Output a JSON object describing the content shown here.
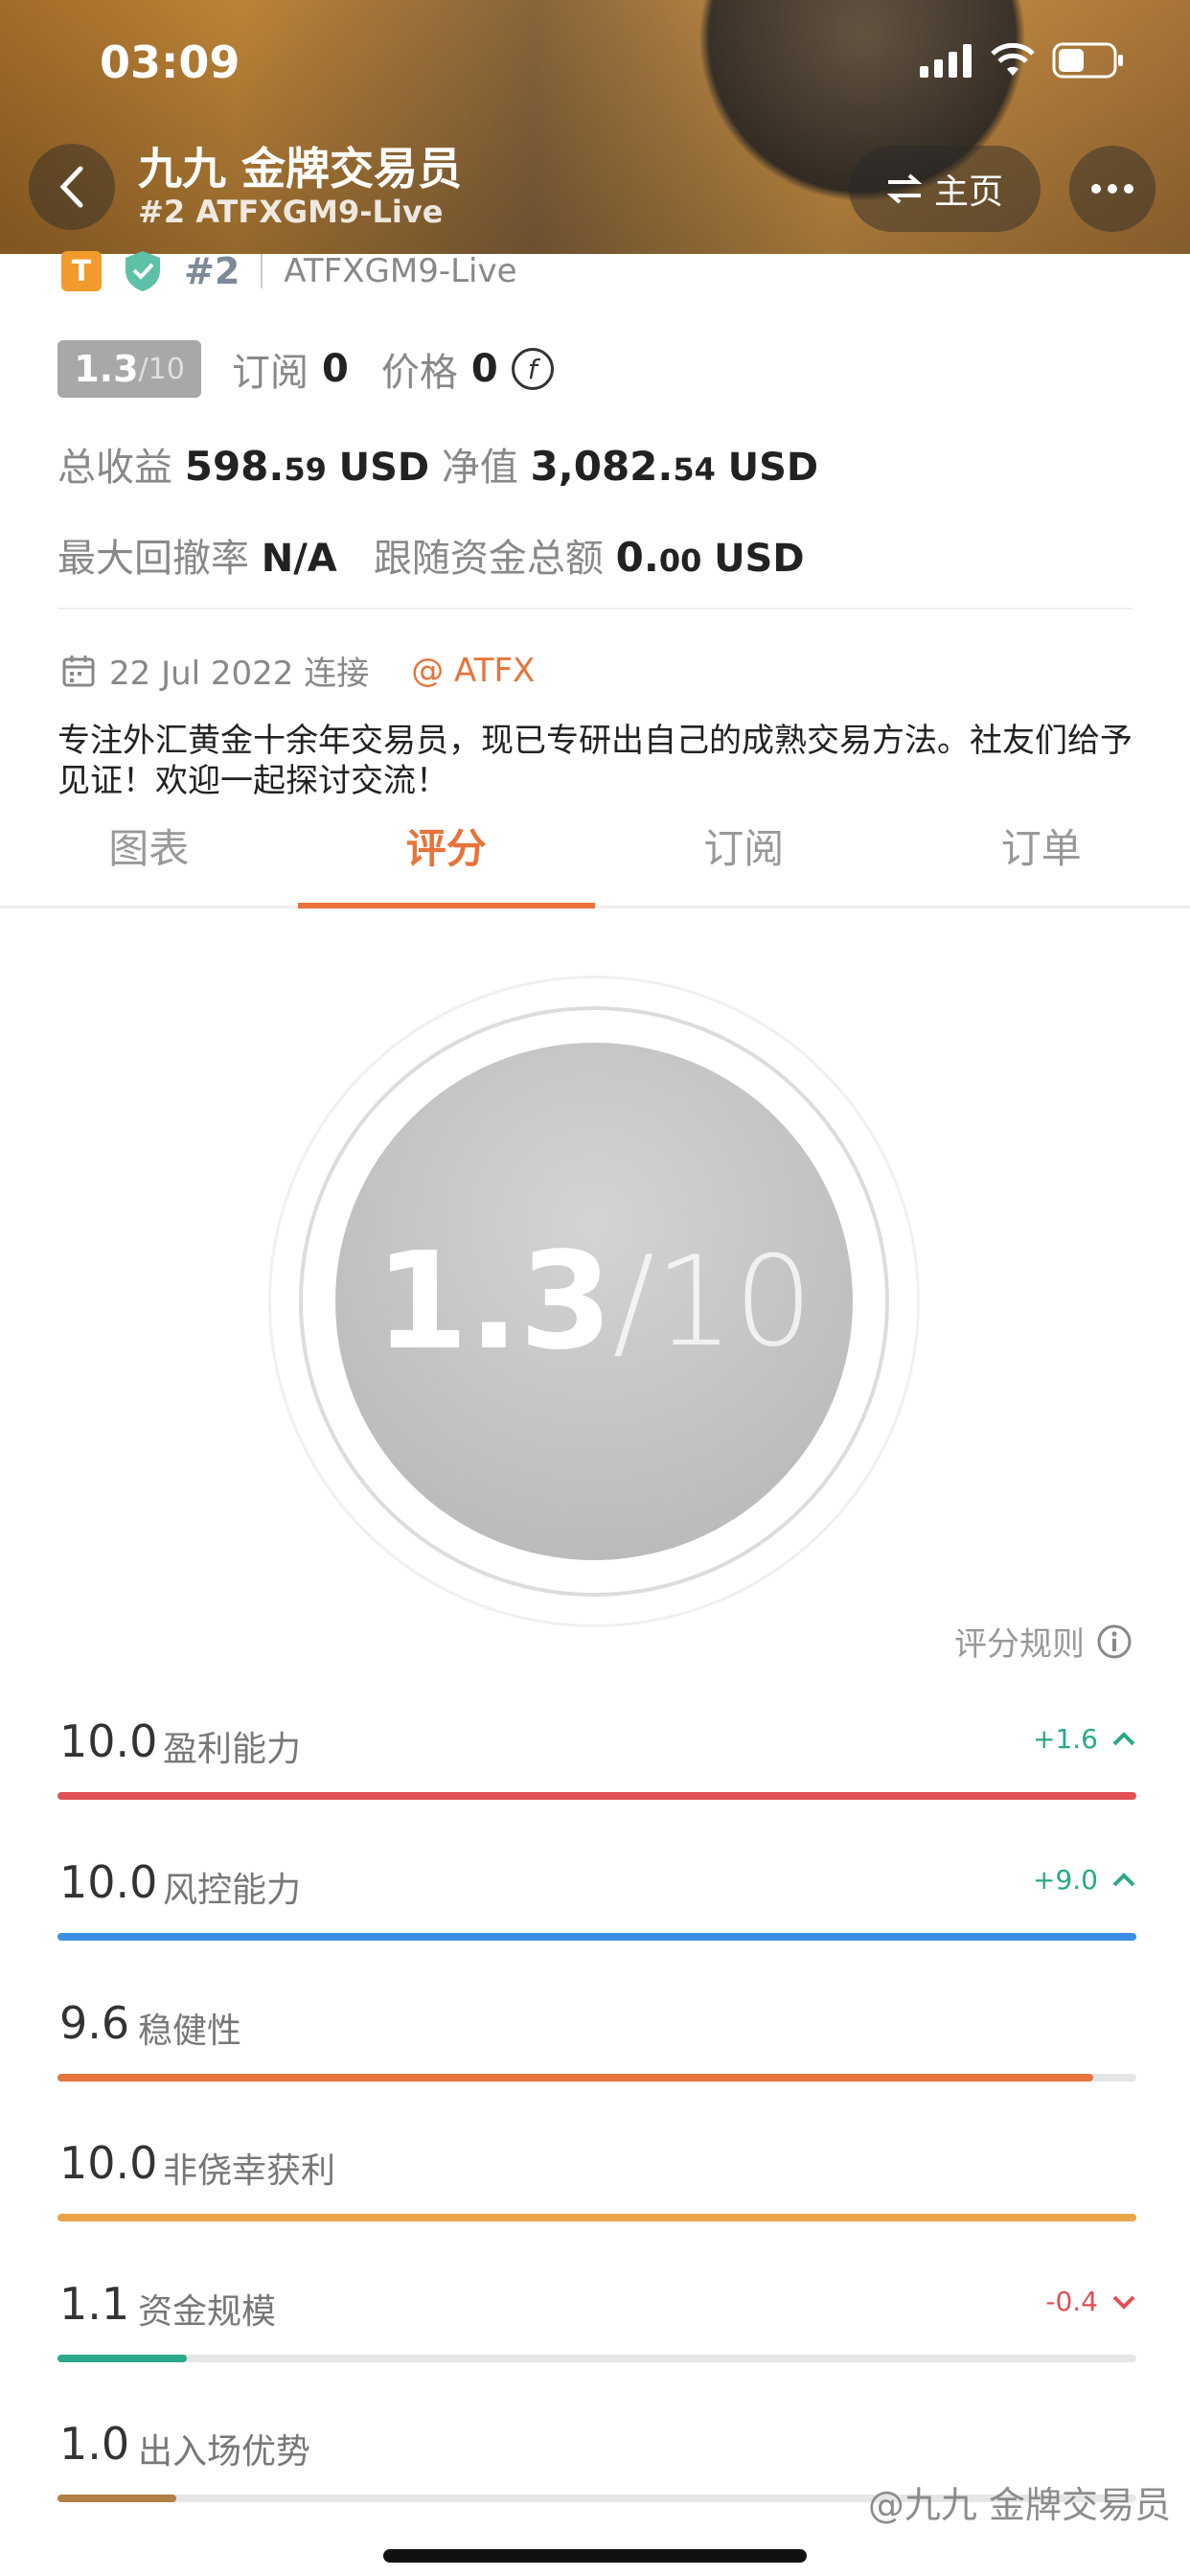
{
  "status": {
    "time": "03:09"
  },
  "header": {
    "title": "九九 金牌交易员",
    "subtitle": "#2 ATFXGM9-Live",
    "home_label": "主页"
  },
  "profile": {
    "badge": "T",
    "rank": "#2",
    "account": "ATFXGM9-Live",
    "score": "1.3",
    "score_max": "/10",
    "subscribe_label": "订阅",
    "subscribe_value": "0",
    "price_label": "价格",
    "price_value": "0",
    "total_profit_label": "总收益",
    "total_profit_int": "598.",
    "total_profit_dec": "59",
    "total_profit_unit": "USD",
    "net_value_label": "净值",
    "net_value_int": "3,082.",
    "net_value_dec": "54",
    "net_value_unit": "USD",
    "drawdown_label": "最大回撤率",
    "drawdown_value": "N/A",
    "follow_label": "跟随资金总额",
    "follow_int": "0.",
    "follow_dec": "00",
    "follow_unit": "USD",
    "date": "22 Jul 2022 连接",
    "broker": "@ ATFX",
    "bio": "专注外汇黄金十余年交易员，现已专研出自己的成熟交易方法。社友们给予见证！欢迎一起探讨交流！"
  },
  "tabs": [
    "图表",
    "评分",
    "订阅",
    "订单"
  ],
  "gauge": {
    "score": "1.3",
    "slash": "/",
    "max": "10"
  },
  "rules_label": "评分规则",
  "metrics": [
    {
      "value": "10.0",
      "label": "盈利能力",
      "delta": "+1.6",
      "direction": "up",
      "level": 1.0,
      "color": "#e05055"
    },
    {
      "value": "10.0",
      "label": "风控能力",
      "delta": "+9.0",
      "direction": "up",
      "level": 1.0,
      "color": "#3a8ee6"
    },
    {
      "value": "9.6",
      "label": "稳健性",
      "delta": "",
      "direction": "",
      "level": 0.96,
      "color": "#e9733a"
    },
    {
      "value": "10.0",
      "label": "非侥幸获利",
      "delta": "",
      "direction": "",
      "level": 1.0,
      "color": "#eaa548"
    },
    {
      "value": "1.1",
      "label": "资金规模",
      "delta": "-0.4",
      "direction": "down",
      "level": 0.12,
      "color": "#2aa88a"
    },
    {
      "value": "1.0",
      "label": "出入场优势",
      "delta": "",
      "direction": "",
      "level": 0.11,
      "color": "#b08048"
    }
  ],
  "colors": {
    "accent": "#e9733a",
    "up": "#2aa88a",
    "down": "#e05055"
  },
  "watermark": "@九九 金牌交易员"
}
